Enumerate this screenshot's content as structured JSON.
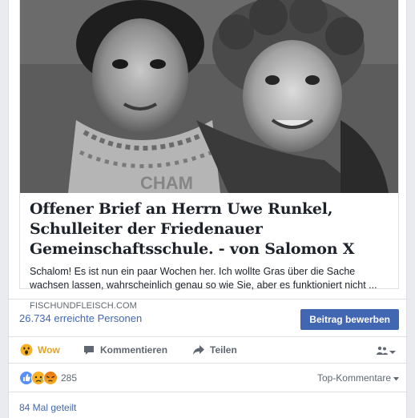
{
  "link_preview": {
    "title": "Offener Brief an Herrn Uwe Runkel, Schulleiter der Friedenauer Gemeinschaftsschule. - von Salomon X",
    "description": "Schalom! Es ist nun ein paar Wochen her. Ich wollte Gras über die Sache wachsen lassen, wahrscheinlich genau so wie Sie, aber es funktioniert nicht ...",
    "domain": "FISCHUNDFLEISCH.COM",
    "image_text": "CHAM"
  },
  "reach": {
    "text": "26.734 erreichte Personen",
    "boost_label": "Beitrag bewerben"
  },
  "actions": {
    "wow_label": "Wow",
    "comment_label": "Kommentieren",
    "share_label": "Teilen"
  },
  "reactions": {
    "count": "285",
    "sort_label": "Top-Kommentare"
  },
  "shares": {
    "text": "84 Mal geteilt"
  },
  "colors": {
    "link_blue": "#4267b2",
    "wow_yellow": "#f7b125",
    "angry_orange": "#e9710f",
    "like_blue": "#5890ff"
  }
}
